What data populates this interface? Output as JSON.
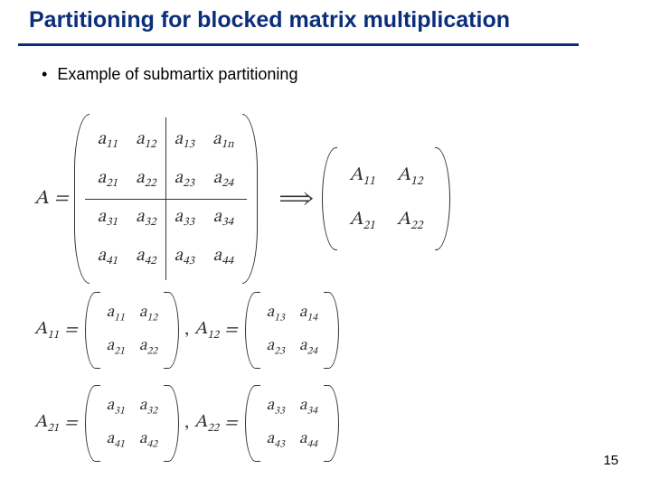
{
  "title": "Partitioning for blocked matrix multiplication",
  "bullet": "Example of submartix partitioning",
  "lhs": "A",
  "equals": "=",
  "bigmatrix": {
    "row0": [
      "a",
      "a",
      "a",
      "a"
    ],
    "row0_sub": [
      "11",
      "12",
      "13",
      "1n"
    ],
    "row1": [
      "a",
      "a",
      "a",
      "a"
    ],
    "row1_sub": [
      "21",
      "22",
      "23",
      "24"
    ],
    "row2": [
      "a",
      "a",
      "a",
      "a"
    ],
    "row2_sub": [
      "31",
      "32",
      "33",
      "34"
    ],
    "row3": [
      "a",
      "a",
      "a",
      "a"
    ],
    "row3_sub": [
      "41",
      "42",
      "43",
      "44"
    ]
  },
  "arrow": "⟹",
  "block": {
    "b00": "A",
    "b00s": "11",
    "b01": "A",
    "b01s": "12",
    "b10": "A",
    "b10s": "21",
    "b11": "A",
    "b11s": "22"
  },
  "defs": {
    "l11": "A",
    "l11s": "11",
    "l12": "A",
    "l12s": "12",
    "l21": "A",
    "l21s": "21",
    "l22": "A",
    "l22s": "22",
    "m11": {
      "a00": "a",
      "a00s": "11",
      "a01": "a",
      "a01s": "12",
      "a10": "a",
      "a10s": "21",
      "a11": "a",
      "a11s": "22"
    },
    "m12": {
      "a00": "a",
      "a00s": "13",
      "a01": "a",
      "a01s": "14",
      "a10": "a",
      "a10s": "23",
      "a11": "a",
      "a11s": "24"
    },
    "m21": {
      "a00": "a",
      "a00s": "31",
      "a01": "a",
      "a01s": "32",
      "a10": "a",
      "a10s": "41",
      "a11": "a",
      "a11s": "42"
    },
    "m22": {
      "a00": "a",
      "a00s": "33",
      "a01": "a",
      "a01s": "34",
      "a10": "a",
      "a10s": "43",
      "a11": "a",
      "a11s": "44"
    }
  },
  "comma": ",",
  "pagenum": "15"
}
